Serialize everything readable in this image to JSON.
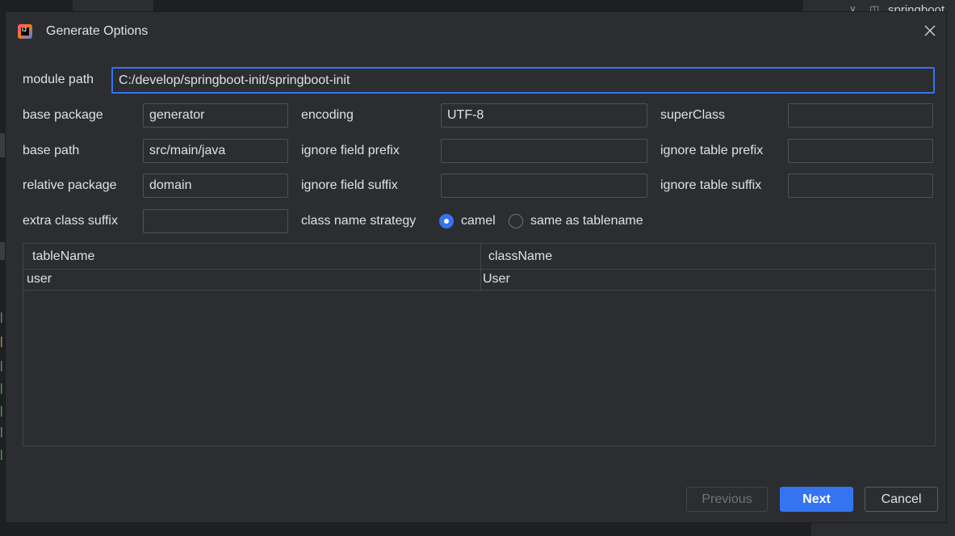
{
  "dialog": {
    "title": "Generate Options",
    "icon": "intellij-idea-icon"
  },
  "form": {
    "module_path": {
      "label": "module path",
      "value": "C:/develop/springboot-init/springboot-init"
    },
    "base_package": {
      "label": "base package",
      "value": "generator"
    },
    "encoding": {
      "label": "encoding",
      "value": "UTF-8"
    },
    "super_class": {
      "label": "superClass",
      "value": ""
    },
    "base_path": {
      "label": "base path",
      "value": "src/main/java"
    },
    "ignore_field_prefix": {
      "label": "ignore field prefix",
      "value": ""
    },
    "ignore_table_prefix": {
      "label": "ignore table prefix",
      "value": ""
    },
    "relative_package": {
      "label": "relative package",
      "value": "domain"
    },
    "ignore_field_suffix": {
      "label": "ignore field suffix",
      "value": ""
    },
    "ignore_table_suffix": {
      "label": "ignore table suffix",
      "value": ""
    },
    "extra_class_suffix": {
      "label": "extra class suffix",
      "value": ""
    },
    "class_name_strategy": {
      "label": "class name strategy",
      "options": [
        {
          "label": "camel",
          "selected": true
        },
        {
          "label": "same as tablename",
          "selected": false
        }
      ]
    }
  },
  "table": {
    "columns": [
      "tableName",
      "className"
    ],
    "rows": [
      [
        "user",
        "User"
      ]
    ]
  },
  "buttons": {
    "previous": "Previous",
    "next": "Next",
    "cancel": "Cancel"
  },
  "background": {
    "right_panel_label": "springboot"
  },
  "colors": {
    "accent": "#3574f0",
    "dialog_bg": "#2b2d30",
    "text": "#dfe1e5"
  }
}
